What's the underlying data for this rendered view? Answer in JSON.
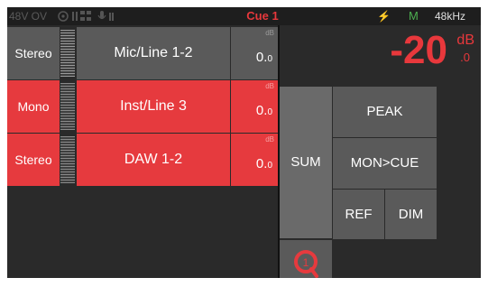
{
  "status_bar": {
    "phantom": "48V OV",
    "cue_title": "Cue 1",
    "power_glyph": "⚡",
    "mode": "M",
    "sample_rate": "48kHz"
  },
  "channels": [
    {
      "mode": "Stereo",
      "name": "Mic/Line 1-2",
      "gain": "0.",
      "gain_dec": "0",
      "unit": "dB",
      "state": "gray"
    },
    {
      "mode": "Mono",
      "name": "Inst/Line 3",
      "gain": "0.",
      "gain_dec": "0",
      "unit": "dB",
      "state": "red"
    },
    {
      "mode": "Stereo",
      "name": "DAW 1-2",
      "gain": "0.",
      "gain_dec": "0",
      "unit": "dB",
      "state": "red"
    }
  ],
  "level": {
    "value": "-20",
    "decimal": ".0",
    "unit": "dB"
  },
  "controls": {
    "sum": "SUM",
    "peak": "PEAK",
    "mon_cue": "MON>CUE",
    "ref": "REF",
    "dim": "DIM",
    "cue_number": "1"
  },
  "colors": {
    "accent_red": "#e63a3e",
    "button_gray": "#5a5a5a",
    "status_green": "#4caf50"
  }
}
